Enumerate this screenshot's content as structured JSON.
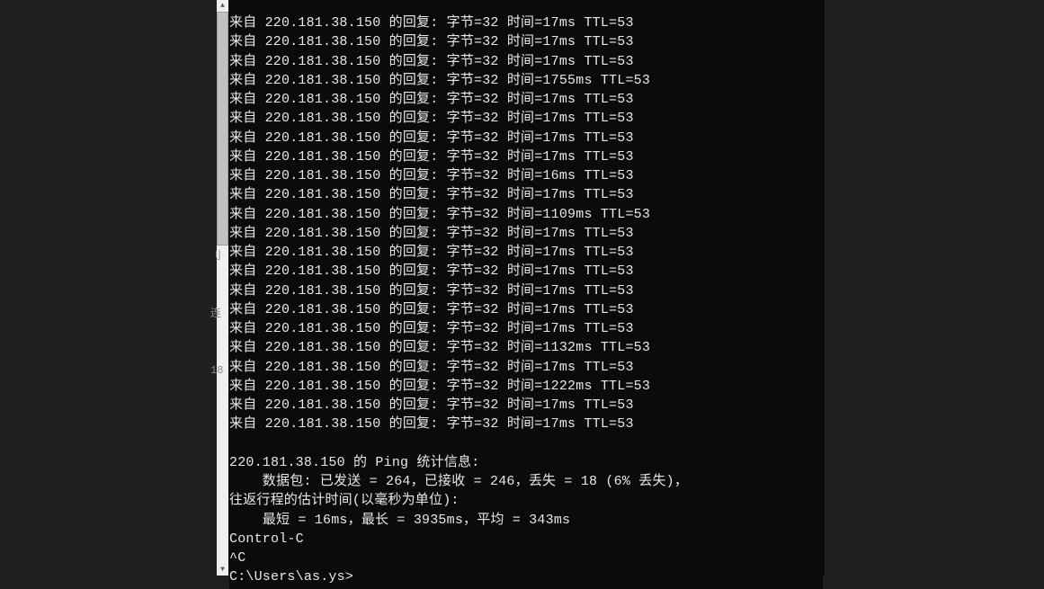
{
  "ping": {
    "reply_prefix": "来自 ",
    "ip": "220.181.38.150",
    "reply_suffix": " 的回复: ",
    "bytes_label": "字节=",
    "bytes": 32,
    "time_label": " 时间=",
    "ttl_label": " TTL=",
    "ttl": 53,
    "replies_ms": [
      17,
      17,
      17,
      1755,
      17,
      17,
      17,
      17,
      16,
      17,
      1109,
      17,
      17,
      17,
      17,
      17,
      17,
      1132,
      17,
      1222,
      17,
      17
    ],
    "stats_header": "220.181.38.150 的 Ping 统计信息:",
    "packets_line": "    数据包: 已发送 = 264，已接收 = 246，丢失 = 18 (6% 丢失)，",
    "rtt_header": "往返行程的估计时间(以毫秒为单位):",
    "rtt_line": "    最短 = 16ms，最长 = 3935ms，平均 = 343ms",
    "control_c": "Control-C",
    "caret_c": "^C",
    "prompt": "C:\\Users\\as.ys>"
  },
  "chart_data": {
    "type": "table",
    "title": "Ping replies from 220.181.38.150",
    "columns": [
      "bytes",
      "time_ms",
      "ttl"
    ],
    "rows": [
      [
        32,
        17,
        53
      ],
      [
        32,
        17,
        53
      ],
      [
        32,
        17,
        53
      ],
      [
        32,
        1755,
        53
      ],
      [
        32,
        17,
        53
      ],
      [
        32,
        17,
        53
      ],
      [
        32,
        17,
        53
      ],
      [
        32,
        17,
        53
      ],
      [
        32,
        16,
        53
      ],
      [
        32,
        17,
        53
      ],
      [
        32,
        1109,
        53
      ],
      [
        32,
        17,
        53
      ],
      [
        32,
        17,
        53
      ],
      [
        32,
        17,
        53
      ],
      [
        32,
        17,
        53
      ],
      [
        32,
        17,
        53
      ],
      [
        32,
        17,
        53
      ],
      [
        32,
        1132,
        53
      ],
      [
        32,
        17,
        53
      ],
      [
        32,
        1222,
        53
      ],
      [
        32,
        17,
        53
      ],
      [
        32,
        17,
        53
      ]
    ],
    "summary": {
      "sent": 264,
      "received": 246,
      "lost": 18,
      "loss_pct": 6,
      "min_ms": 16,
      "max_ms": 3935,
      "avg_ms": 343
    }
  },
  "edge_fragments": [
    "刂",
    " ",
    " ",
    "连",
    " ",
    "18"
  ]
}
